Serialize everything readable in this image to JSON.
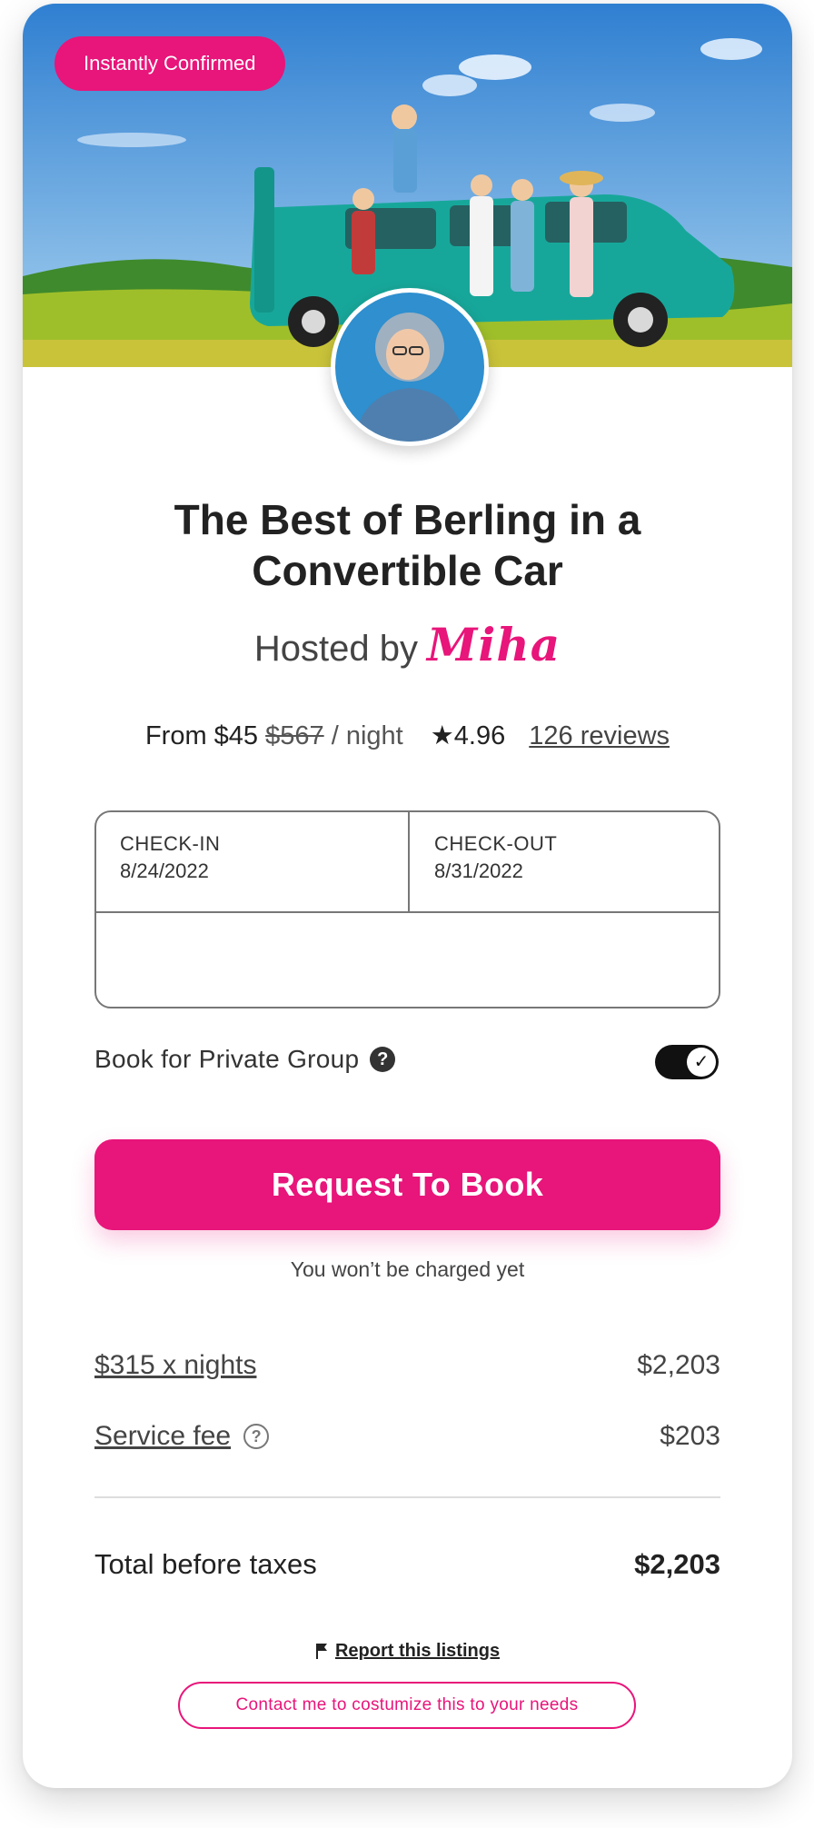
{
  "listing": {
    "badge": "Instantly Confirmed",
    "title": "The Best of Berling in a Convertible Car",
    "hosted_by_label": "Hosted by",
    "host_name": "Miha"
  },
  "pricing": {
    "from_label": "From $45",
    "old_price": "$567",
    "per_night": "/ night",
    "rating": "★4.96",
    "reviews_link": "126 reviews"
  },
  "booking": {
    "checkin_label": "CHECK-IN",
    "checkin_value": "8/24/2022",
    "checkout_label": "CHECK-OUT",
    "checkout_value": "8/31/2022",
    "private_group_label": "Book for Private Group",
    "private_group_enabled": true,
    "book_button": "Request To Book",
    "no_charge_note": "You won’t be charged yet"
  },
  "fees": {
    "nights_label": "$315 x nights",
    "nights_amount": "$2,203",
    "service_label": "Service fee",
    "service_amount": "$203",
    "total_label": "Total before taxes",
    "total_amount": "$2,203"
  },
  "footer": {
    "report_link": "Report this listings",
    "contact_button": "Contact me to costumize this to your needs"
  },
  "icons": {
    "help": "question-circle-icon",
    "flag": "flag-icon",
    "check": "checkmark-icon"
  },
  "colors": {
    "brand": "#e8157a",
    "text": "#222222",
    "muted": "#444444"
  }
}
